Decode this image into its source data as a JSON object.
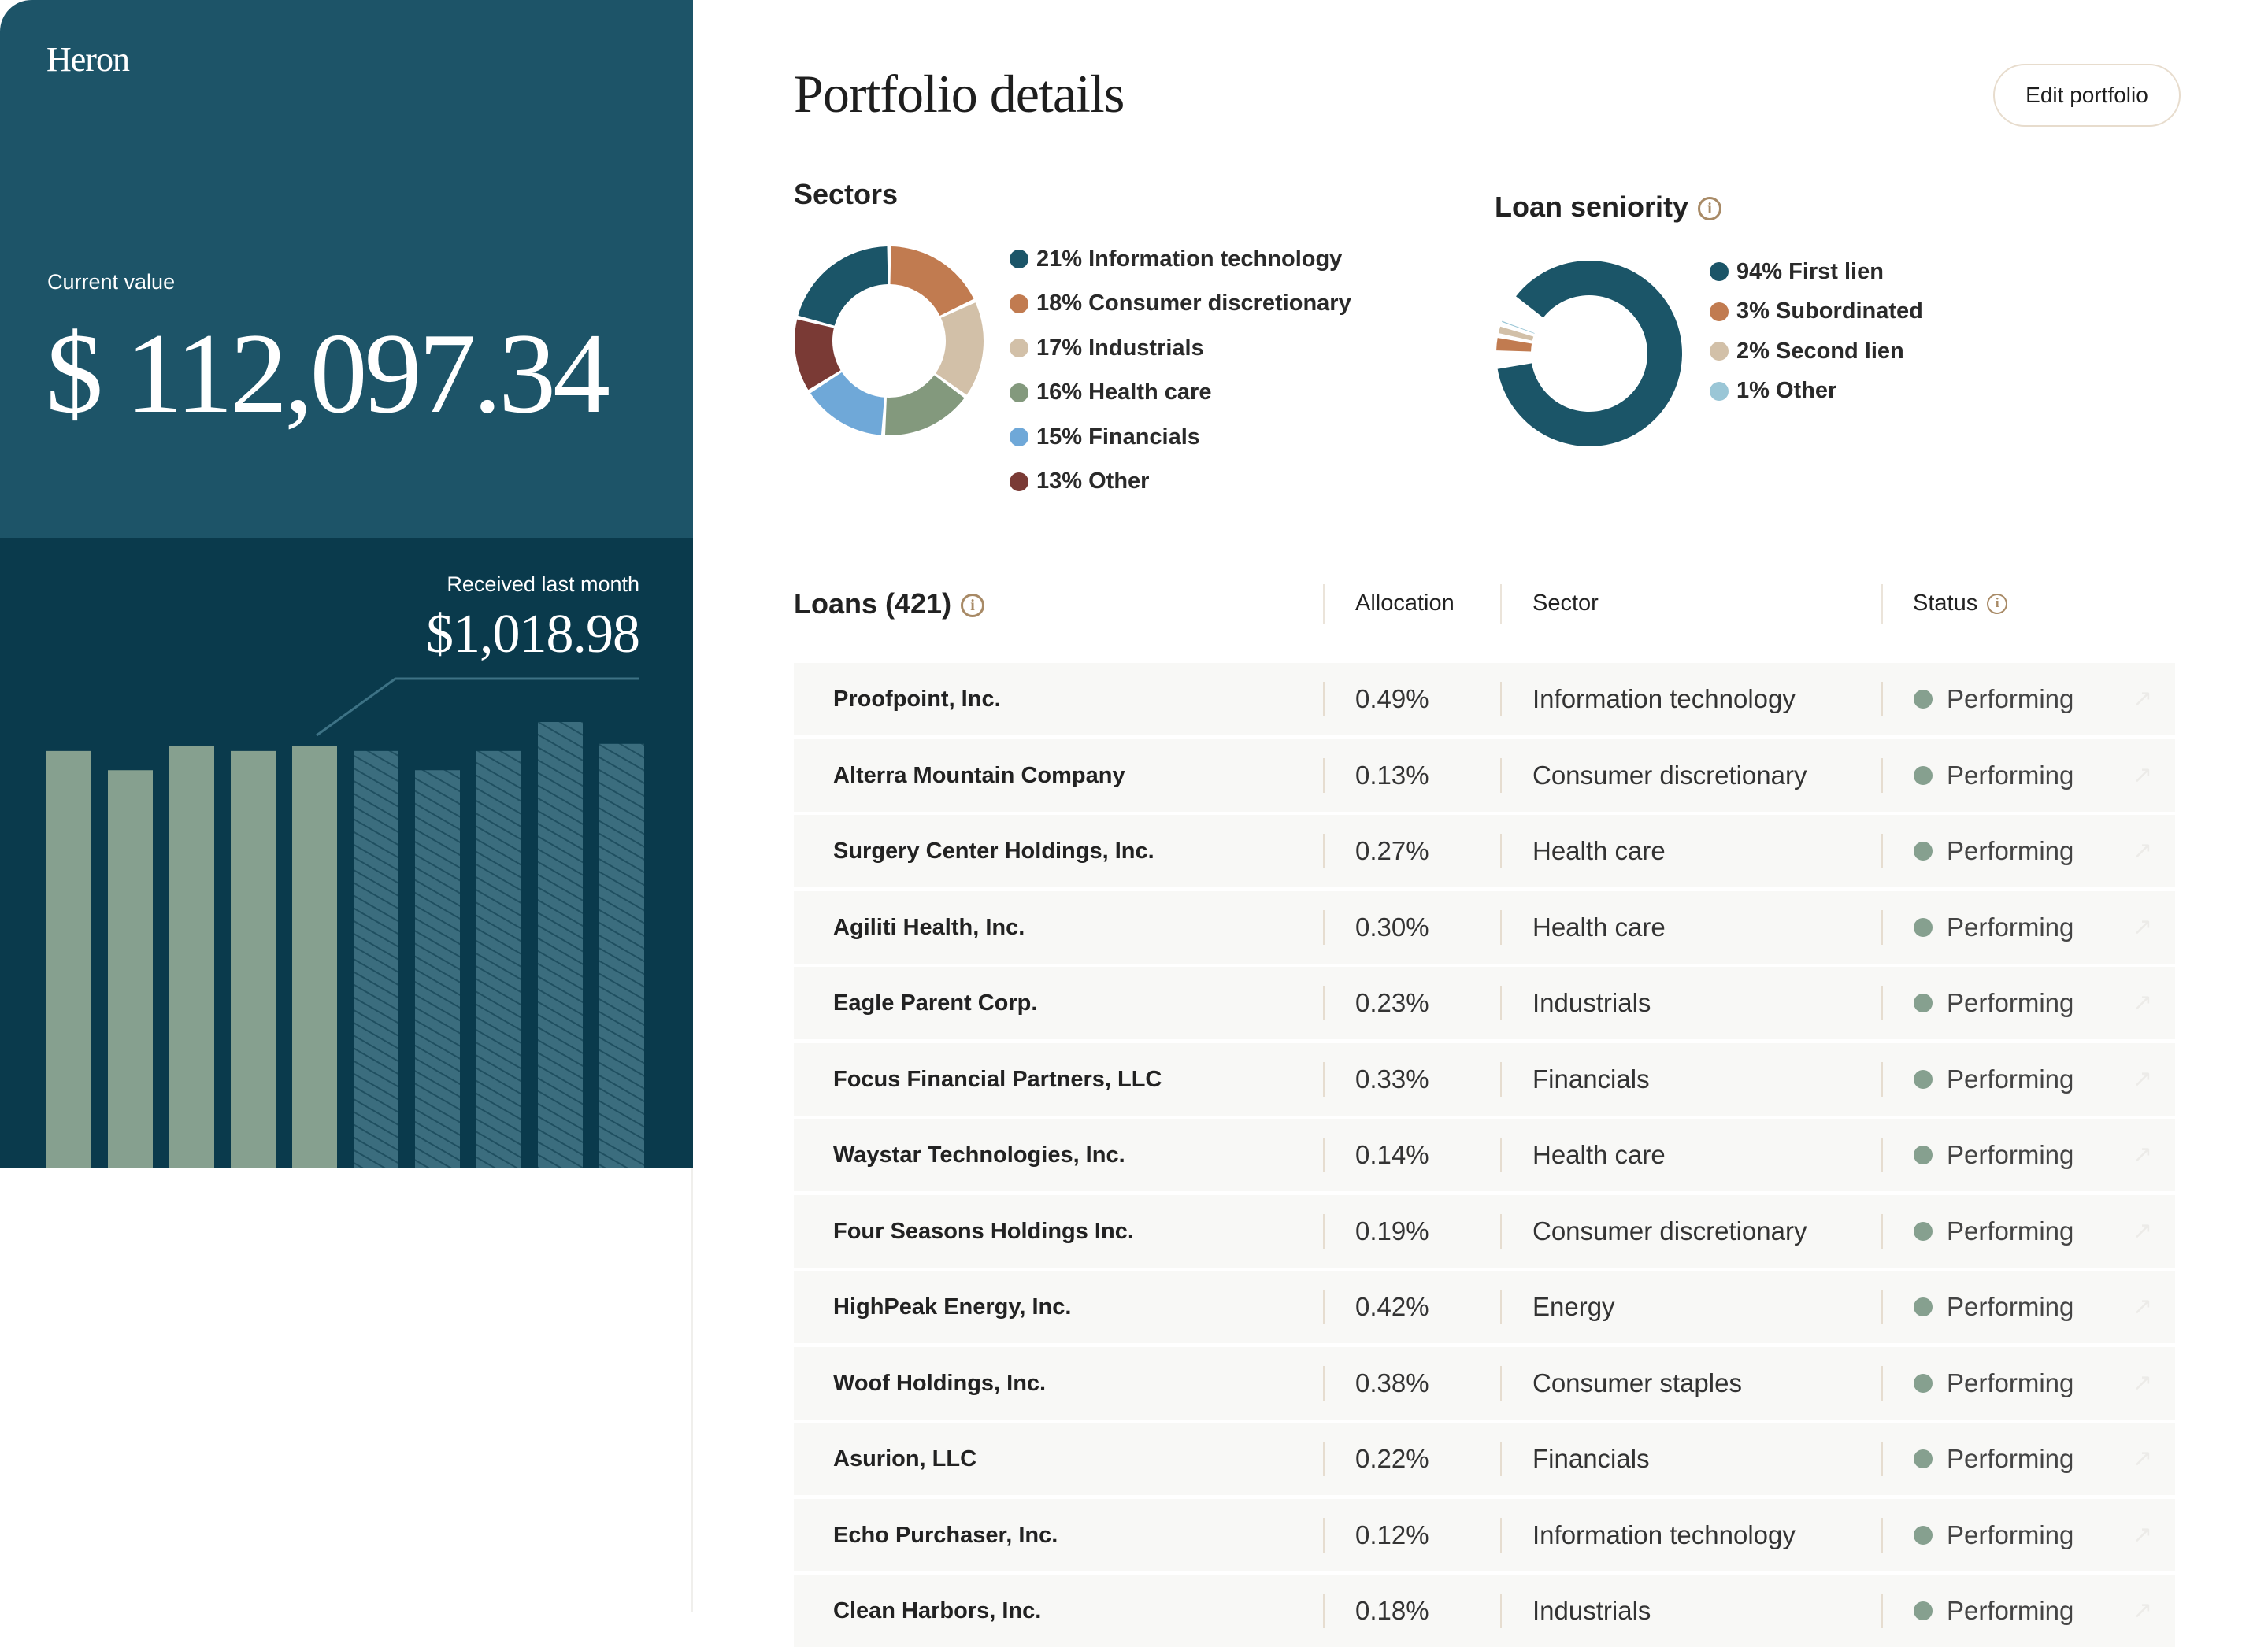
{
  "sidebar": {
    "logo": "Heron",
    "current_value_label": "Current value",
    "current_value": "$ 112,097.34",
    "received_label": "Received last month",
    "received_value": "$1,018.98",
    "bar_chart": {
      "type": "bar",
      "relative_heights": [
        0.935,
        0.892,
        0.947,
        0.935,
        0.947,
        0.935,
        0.892,
        0.935,
        1.0,
        0.951
      ],
      "styles": [
        "solid",
        "solid",
        "solid",
        "solid",
        "solid",
        "hatched",
        "hatched",
        "hatched",
        "hatched",
        "hatched"
      ],
      "highlighted_index": 4,
      "colors": {
        "solid": "#86a08f",
        "hatched": "#3b6d7e"
      }
    }
  },
  "header": {
    "title": "Portfolio details",
    "edit_button": "Edit portfolio"
  },
  "sectors": {
    "title": "Sectors",
    "items": [
      {
        "label": "21% Information technology",
        "value": 21,
        "color": "#1b5568"
      },
      {
        "label": "18% Consumer discretionary",
        "value": 18,
        "color": "#c17b50"
      },
      {
        "label": "17% Industrials",
        "value": 17,
        "color": "#d2c0a8"
      },
      {
        "label": "16% Health care",
        "value": 16,
        "color": "#83997d"
      },
      {
        "label": "15% Financials",
        "value": 15,
        "color": "#6fa8d8"
      },
      {
        "label": "13% Other",
        "value": 13,
        "color": "#7a3a35"
      }
    ]
  },
  "seniority": {
    "title": "Loan seniority",
    "info_icon": "i",
    "items": [
      {
        "label": "94% First lien",
        "value": 94,
        "color": "#1b5568"
      },
      {
        "label": "3% Subordinated",
        "value": 3,
        "color": "#c17b50"
      },
      {
        "label": "2% Second lien",
        "value": 2,
        "color": "#d2c0a8"
      },
      {
        "label": "1% Other",
        "value": 1,
        "color": "#9ac6d6"
      }
    ]
  },
  "loans": {
    "title": "Loans (421)",
    "info_icon": "i",
    "columns": {
      "allocation": "Allocation",
      "sector": "Sector",
      "status": "Status"
    },
    "status_color": "#86a08f",
    "arrow_icon": "↗",
    "rows": [
      {
        "name": "Proofpoint, Inc.",
        "allocation": "0.49%",
        "sector": "Information technology",
        "status": "Performing"
      },
      {
        "name": "Alterra Mountain Company",
        "allocation": "0.13%",
        "sector": "Consumer discretionary",
        "status": "Performing"
      },
      {
        "name": "Surgery Center Holdings, Inc.",
        "allocation": "0.27%",
        "sector": "Health care",
        "status": "Performing"
      },
      {
        "name": "Agiliti Health, Inc.",
        "allocation": "0.30%",
        "sector": "Health care",
        "status": "Performing"
      },
      {
        "name": "Eagle Parent Corp.",
        "allocation": "0.23%",
        "sector": "Industrials",
        "status": "Performing"
      },
      {
        "name": "Focus Financial Partners, LLC",
        "allocation": "0.33%",
        "sector": "Financials",
        "status": "Performing"
      },
      {
        "name": "Waystar Technologies, Inc.",
        "allocation": "0.14%",
        "sector": "Health care",
        "status": "Performing"
      },
      {
        "name": "Four Seasons Holdings Inc.",
        "allocation": "0.19%",
        "sector": "Consumer discretionary",
        "status": "Performing"
      },
      {
        "name": "HighPeak Energy, Inc.",
        "allocation": "0.42%",
        "sector": "Energy",
        "status": "Performing"
      },
      {
        "name": "Woof Holdings, Inc.",
        "allocation": "0.38%",
        "sector": "Consumer staples",
        "status": "Performing"
      },
      {
        "name": "Asurion, LLC",
        "allocation": "0.22%",
        "sector": "Financials",
        "status": "Performing"
      },
      {
        "name": "Echo Purchaser, Inc.",
        "allocation": "0.12%",
        "sector": "Information technology",
        "status": "Performing"
      },
      {
        "name": "Clean Harbors, Inc.",
        "allocation": "0.18%",
        "sector": "Industrials",
        "status": "Performing"
      }
    ]
  }
}
